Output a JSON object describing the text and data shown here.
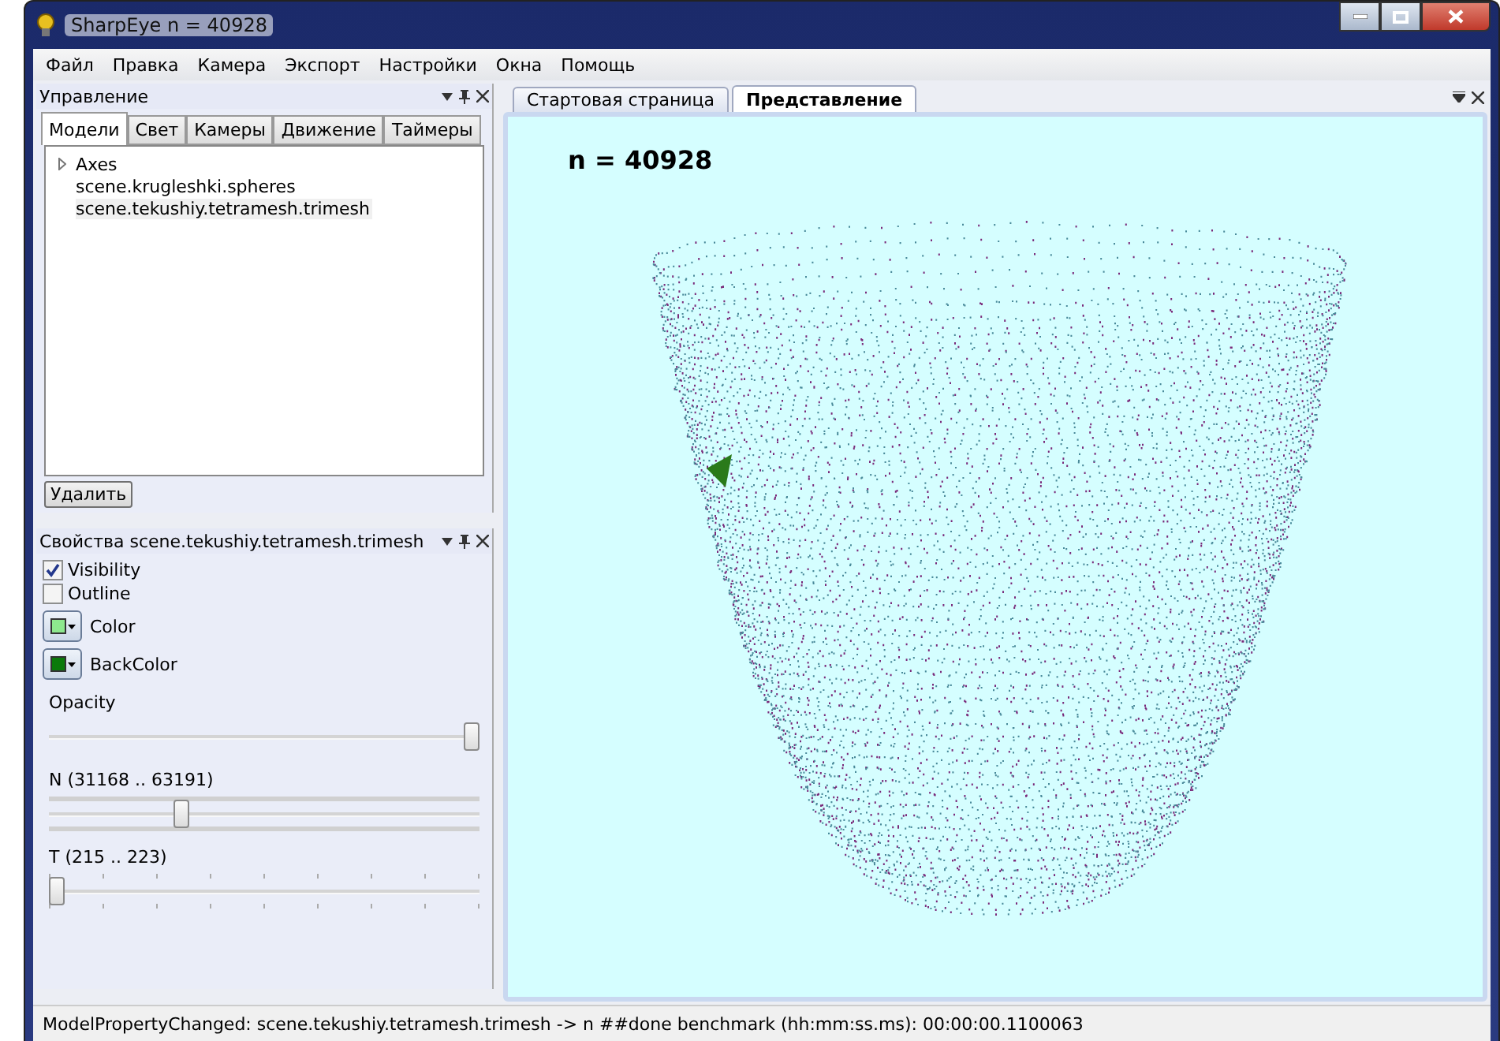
{
  "window": {
    "title": "SharpEye n = 40928"
  },
  "menu": [
    "Файл",
    "Правка",
    "Камера",
    "Экспорт",
    "Настройки",
    "Окна",
    "Помощь"
  ],
  "control_panel": {
    "title": "Управление",
    "tabs": [
      {
        "label": "Модели",
        "selected": true
      },
      {
        "label": "Свет",
        "selected": false
      },
      {
        "label": "Камеры",
        "selected": false
      },
      {
        "label": "Движение",
        "selected": false
      },
      {
        "label": "Таймеры",
        "selected": false
      }
    ],
    "tree": [
      {
        "label": "Axes",
        "expandable": true,
        "selected": false
      },
      {
        "label": "scene.krugleshki.spheres",
        "expandable": false,
        "selected": false
      },
      {
        "label": "scene.tekushiy.tetramesh.trimesh",
        "expandable": false,
        "selected": true
      }
    ],
    "delete_button": "Удалить"
  },
  "properties_panel": {
    "title": "Свойства scene.tekushiy.tetramesh.trimesh",
    "checkboxes": [
      {
        "label": "Visibility",
        "checked": true
      },
      {
        "label": "Outline",
        "checked": false
      }
    ],
    "color_pickers": [
      {
        "label": "Color",
        "color": "#8ee88e"
      },
      {
        "label": "BackColor",
        "color": "#0a7a0a"
      }
    ],
    "sliders": [
      {
        "label": "Opacity",
        "level": 1,
        "kind": "plain"
      },
      {
        "label": "N (31168 .. 63191)",
        "level": 0.3,
        "kind": "rails"
      },
      {
        "label": "T (215 .. 223)",
        "level": 0,
        "kind": "ticks"
      }
    ]
  },
  "document_tabs": [
    {
      "label": "Стартовая страница",
      "selected": false
    },
    {
      "label": "Представление",
      "selected": true
    }
  ],
  "viewport": {
    "label": "n = 40928"
  },
  "status_bar": "ModelPropertyChanged: scene.tekushiy.tetramesh.trimesh -> n ##done benchmark (hh:mm:ss.ms): 00:00:00.1100063"
}
